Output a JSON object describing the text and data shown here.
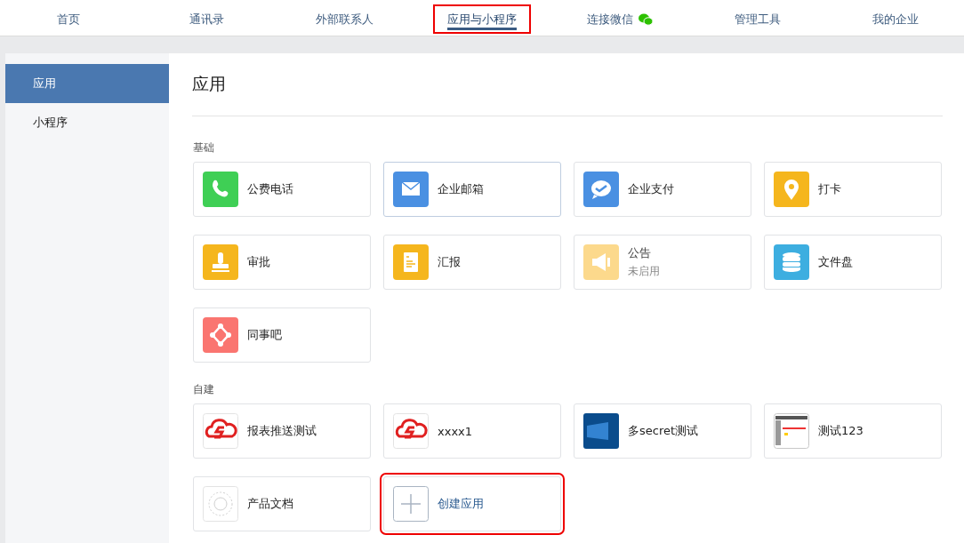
{
  "nav": [
    {
      "label": "首页",
      "selected": false,
      "highlighted": false,
      "wechat": false
    },
    {
      "label": "通讯录",
      "selected": false,
      "highlighted": false,
      "wechat": false
    },
    {
      "label": "外部联系人",
      "selected": false,
      "highlighted": false,
      "wechat": false
    },
    {
      "label": "应用与小程序",
      "selected": true,
      "highlighted": true,
      "wechat": false
    },
    {
      "label": "连接微信",
      "selected": false,
      "highlighted": false,
      "wechat": true
    },
    {
      "label": "管理工具",
      "selected": false,
      "highlighted": false,
      "wechat": false
    },
    {
      "label": "我的企业",
      "selected": false,
      "highlighted": false,
      "wechat": false
    }
  ],
  "sidebar": {
    "items": [
      {
        "label": "应用",
        "selected": true
      },
      {
        "label": "小程序",
        "selected": false
      }
    ]
  },
  "title": "应用",
  "sections": [
    {
      "label": "基础",
      "apps": [
        {
          "name": "公费电话",
          "kind": "phone",
          "color": "#3fcf55",
          "disabled": false,
          "selected": false,
          "highlighted": false
        },
        {
          "name": "企业邮箱",
          "kind": "mail",
          "color": "#4a90e2",
          "disabled": false,
          "selected": true,
          "highlighted": false
        },
        {
          "name": "企业支付",
          "kind": "pay",
          "color": "#4a90e2",
          "disabled": false,
          "selected": false,
          "highlighted": false
        },
        {
          "name": "打卡",
          "kind": "pin",
          "color": "#f5b61d",
          "disabled": false,
          "selected": false,
          "highlighted": false
        },
        {
          "name": "审批",
          "kind": "stamp",
          "color": "#f5b61d",
          "disabled": false,
          "selected": false,
          "highlighted": false
        },
        {
          "name": "汇报",
          "kind": "report",
          "color": "#f5b61d",
          "disabled": false,
          "selected": false,
          "highlighted": false
        },
        {
          "name": "公告",
          "status": "未启用",
          "kind": "megaphone",
          "color": "#fcd98c",
          "disabled": true,
          "selected": false,
          "highlighted": false
        },
        {
          "name": "文件盘",
          "kind": "disk",
          "color": "#3daee0",
          "disabled": false,
          "selected": false,
          "highlighted": false
        },
        {
          "name": "同事吧",
          "kind": "network",
          "color": "#fa7570",
          "disabled": false,
          "selected": false,
          "highlighted": false
        }
      ]
    },
    {
      "label": "自建",
      "apps": [
        {
          "name": "报表推送测试",
          "kind": "cloud",
          "color": "#e02020",
          "disabled": false,
          "selected": false,
          "highlighted": false
        },
        {
          "name": "xxxx1",
          "kind": "cloud",
          "color": "#e02020",
          "disabled": false,
          "selected": false,
          "highlighted": false
        },
        {
          "name": "多secret测试",
          "kind": "desktop",
          "color": "#0a4c8c",
          "disabled": false,
          "selected": false,
          "highlighted": false
        },
        {
          "name": "测试123",
          "kind": "screenshot",
          "color": "#c8c8c8",
          "disabled": false,
          "selected": false,
          "highlighted": false
        },
        {
          "name": "产品文档",
          "kind": "circle",
          "color": "#e3e3e3",
          "disabled": false,
          "selected": false,
          "highlighted": false
        },
        {
          "name": "创建应用",
          "kind": "add",
          "color": "#a9b4c2",
          "disabled": false,
          "selected": false,
          "highlighted": true
        }
      ]
    }
  ]
}
